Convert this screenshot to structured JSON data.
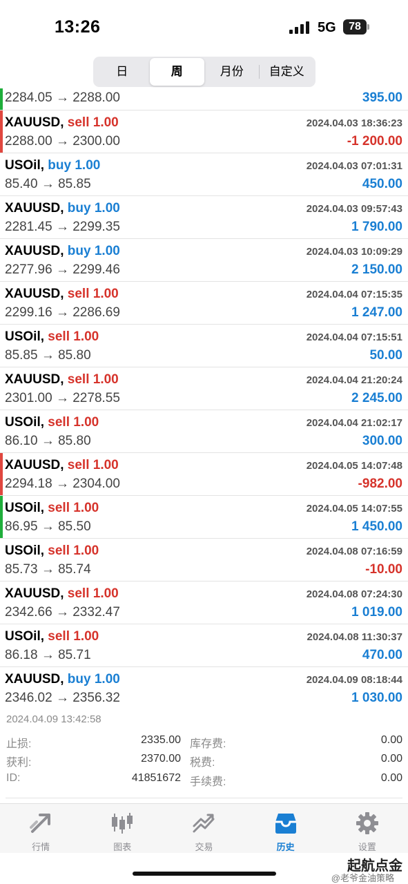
{
  "status_bar": {
    "time": "13:26",
    "network": "5G",
    "battery": "78"
  },
  "segments": [
    {
      "label": "日",
      "active": false
    },
    {
      "label": "周",
      "active": true
    },
    {
      "label": "月份",
      "active": false
    },
    {
      "label": "自定义",
      "active": false
    }
  ],
  "partial_row": {
    "prices": "2284.05 → 2288.00",
    "profit": "395.00"
  },
  "trades": [
    {
      "symbol": "XAUUSD,",
      "direction": "sell 1.00",
      "time": "2024.04.03 18:36:23",
      "prices": "2288.00 → 2300.00",
      "profit": "-1 200.00"
    },
    {
      "symbol": "USOil,",
      "direction": "buy 1.00",
      "time": "2024.04.03 07:01:31",
      "prices": "85.40 → 85.85",
      "profit": "450.00"
    },
    {
      "symbol": "XAUUSD,",
      "direction": "buy 1.00",
      "time": "2024.04.03 09:57:43",
      "prices": "2281.45 → 2299.35",
      "profit": "1 790.00"
    },
    {
      "symbol": "XAUUSD,",
      "direction": "buy 1.00",
      "time": "2024.04.03 10:09:29",
      "prices": "2277.96 → 2299.46",
      "profit": "2 150.00"
    },
    {
      "symbol": "XAUUSD,",
      "direction": "sell 1.00",
      "time": "2024.04.04 07:15:35",
      "prices": "2299.16 → 2286.69",
      "profit": "1 247.00"
    },
    {
      "symbol": "USOil,",
      "direction": "sell 1.00",
      "time": "2024.04.04 07:15:51",
      "prices": "85.85 → 85.80",
      "profit": "50.00"
    },
    {
      "symbol": "XAUUSD,",
      "direction": "sell 1.00",
      "time": "2024.04.04 21:20:24",
      "prices": "2301.00 → 2278.55",
      "profit": "2 245.00"
    },
    {
      "symbol": "USOil,",
      "direction": "sell 1.00",
      "time": "2024.04.04 21:02:17",
      "prices": "86.10 → 85.80",
      "profit": "300.00"
    },
    {
      "symbol": "XAUUSD,",
      "direction": "sell 1.00",
      "time": "2024.04.05 14:07:48",
      "prices": "2294.18 → 2304.00",
      "profit": "-982.00"
    },
    {
      "symbol": "USOil,",
      "direction": "sell 1.00",
      "time": "2024.04.05 14:07:55",
      "prices": "86.95 → 85.50",
      "profit": "1 450.00"
    },
    {
      "symbol": "USOil,",
      "direction": "sell 1.00",
      "time": "2024.04.08 07:16:59",
      "prices": "85.73 → 85.74",
      "profit": "-10.00"
    },
    {
      "symbol": "XAUUSD,",
      "direction": "sell 1.00",
      "time": "2024.04.08 07:24:30",
      "prices": "2342.66 → 2332.47",
      "profit": "1 019.00"
    },
    {
      "symbol": "USOil,",
      "direction": "sell 1.00",
      "time": "2024.04.08 11:30:37",
      "prices": "86.18 → 85.71",
      "profit": "470.00"
    },
    {
      "symbol": "XAUUSD,",
      "direction": "buy 1.00",
      "time": "2024.04.09 08:18:44",
      "prices": "2346.02 → 2356.32",
      "profit": "1 030.00"
    }
  ],
  "summary": {
    "time": "2024.04.09 13:42:58",
    "stop_loss_label": "止损:",
    "stop_loss_value": "2335.00",
    "take_profit_label": "获利:",
    "take_profit_value": "2370.00",
    "id_label": "ID:",
    "id_value": "41851672",
    "swap_label": "库存费:",
    "swap_value": "0.00",
    "tax_label": "税费:",
    "tax_value": "0.00",
    "commission_label": "手续费:",
    "commission_value": "0.00"
  },
  "tabs": [
    {
      "label": "行情",
      "icon": "quotes-icon",
      "active": false
    },
    {
      "label": "图表",
      "icon": "chart-icon",
      "active": false
    },
    {
      "label": "交易",
      "icon": "trade-icon",
      "active": false
    },
    {
      "label": "历史",
      "icon": "history-icon",
      "active": true
    },
    {
      "label": "设置",
      "icon": "settings-icon",
      "active": false
    }
  ],
  "watermark": {
    "line1": "起航点金",
    "line2": "@老爷金油策略"
  },
  "colors": {
    "buy": "#1a7fd3",
    "sell": "#d6332b",
    "win_bar": "#1fae3b",
    "loss_bar": "#e0473f",
    "tab_active": "#1a7fd3"
  }
}
